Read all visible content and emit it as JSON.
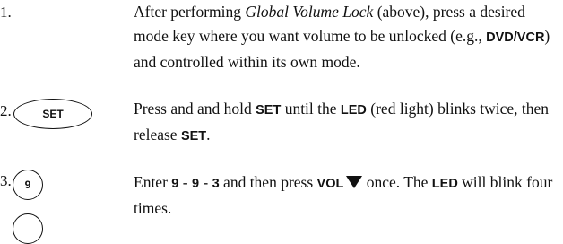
{
  "steps": [
    {
      "number": "1.",
      "text": {
        "t1": "After performing ",
        "italic": "Global Volume Lock",
        "t2": " (above), press a desired mode key where you want volume to be unlocked (e.g., ",
        "bold": "DVD/VCR",
        "t3": ") and controlled within its own mode."
      }
    },
    {
      "number": "2.",
      "key_label": "SET",
      "text": {
        "t1": "Press and and hold ",
        "bold1": "SET",
        "t2": " until the ",
        "bold2": "LED",
        "t3": " (red light) blinks twice, then release ",
        "bold3": "SET",
        "t4": "."
      }
    },
    {
      "number": "3.",
      "key_label": "9",
      "text": {
        "t1": "Enter ",
        "b1": "9",
        "s1": " - ",
        "b2": "9",
        "s2": " - ",
        "b3": "3",
        "t2": " and then press ",
        "b4": "VOL",
        "t3": " once. The ",
        "b5": "LED",
        "t4": " will blink four times."
      }
    }
  ]
}
